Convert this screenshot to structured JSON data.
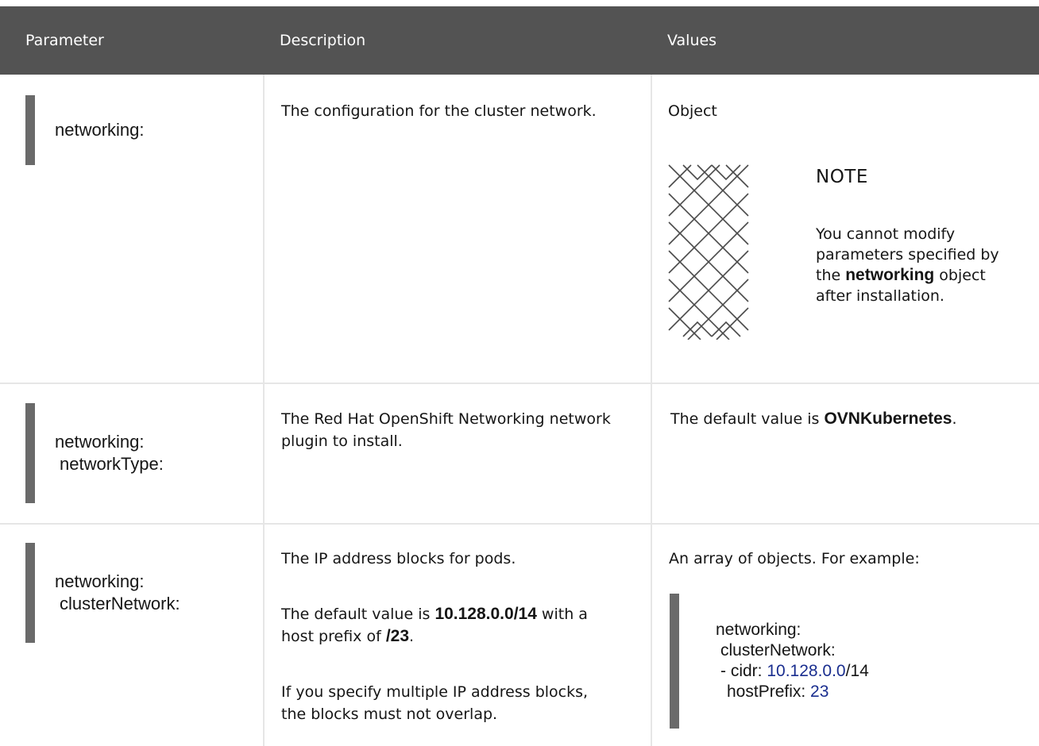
{
  "table": {
    "headers": {
      "parameter": "Parameter",
      "description": "Description",
      "values": "Values"
    },
    "rows": [
      {
        "param_lines": [
          "networking:"
        ],
        "description": "The configuration for the cluster network.",
        "value": "Object",
        "note": {
          "title": "NOTE",
          "text_before": "You cannot modify parameters specified by the ",
          "text_bold": "networking",
          "text_after": " object after installation."
        }
      },
      {
        "param_lines": [
          "networking:",
          "networkType:"
        ],
        "description": "The Red Hat OpenShift Networking network plugin to install.",
        "value_before": "The default value is ",
        "value_bold": "OVNKubernetes",
        "value_after": "."
      },
      {
        "param_lines": [
          "networking:",
          "clusterNetwork:"
        ],
        "description_1": "The IP address blocks for pods.",
        "description_2_before": "The default value is ",
        "description_2_bold": "10.128.0.0/14",
        "description_2_mid": " with a host prefix of ",
        "description_2_bold_2": "/23",
        "description_2_after": ".",
        "description_3": "If you specify multiple IP address blocks, the blocks must not overlap.",
        "value": "An array of objects. For example:",
        "code": {
          "line1": "networking:",
          "line2": "clusterNetwork:",
          "line3_prefix": "- cidr: ",
          "line3_num": "10.128.0.0",
          "line3_suffix": "/14",
          "line4_prefix": "hostPrefix: ",
          "line4_num": "23"
        }
      }
    ]
  }
}
